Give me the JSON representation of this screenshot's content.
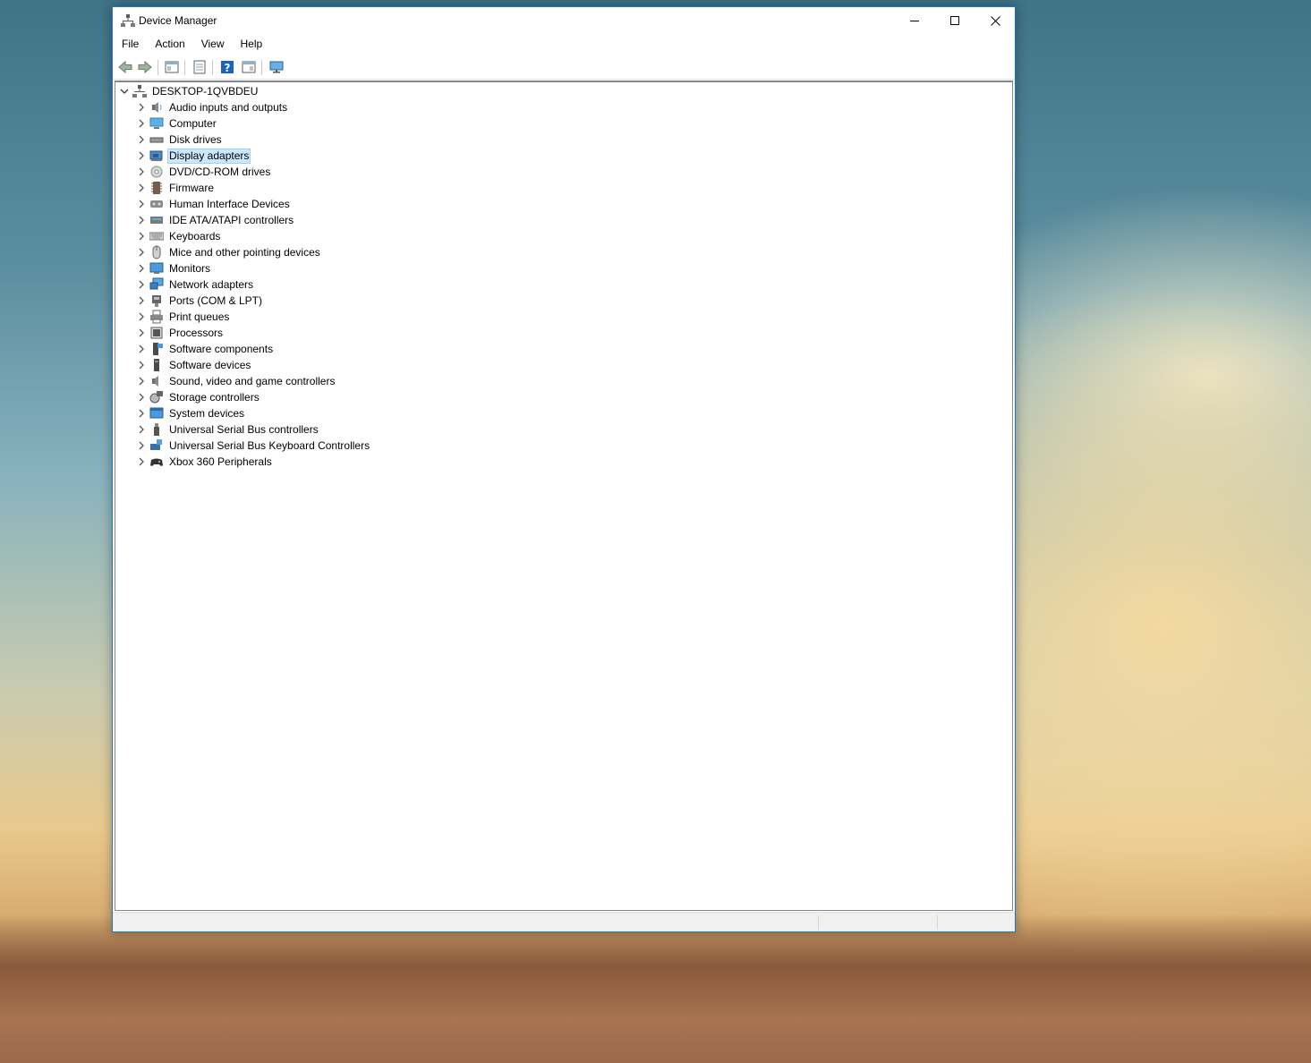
{
  "window": {
    "title": "Device Manager",
    "buttons": {
      "minimize": "minimize",
      "maximize": "maximize",
      "close": "close"
    }
  },
  "menu": {
    "items": [
      "File",
      "Action",
      "View",
      "Help"
    ]
  },
  "toolbar": {
    "buttons": [
      "back-icon",
      "forward-icon",
      "show-hide-console-tree-icon",
      "properties-icon",
      "help-icon",
      "action-pane-icon",
      "monitor-icon"
    ]
  },
  "tree": {
    "root": {
      "label": "DESKTOP-1QVBDEU",
      "expanded": true,
      "icon": "computer-network-icon"
    },
    "items": [
      {
        "label": "Audio inputs and outputs",
        "icon": "speaker-icon"
      },
      {
        "label": "Computer",
        "icon": "computer-icon"
      },
      {
        "label": "Disk drives",
        "icon": "disk-drive-icon"
      },
      {
        "label": "Display adapters",
        "icon": "display-adapter-icon",
        "selected": true
      },
      {
        "label": "DVD/CD-ROM drives",
        "icon": "dvd-icon"
      },
      {
        "label": "Firmware",
        "icon": "firmware-icon"
      },
      {
        "label": "Human Interface Devices",
        "icon": "hid-icon"
      },
      {
        "label": "IDE ATA/ATAPI controllers",
        "icon": "ide-controller-icon"
      },
      {
        "label": "Keyboards",
        "icon": "keyboard-icon"
      },
      {
        "label": "Mice and other pointing devices",
        "icon": "mouse-icon"
      },
      {
        "label": "Monitors",
        "icon": "monitor-icon"
      },
      {
        "label": "Network adapters",
        "icon": "network-adapter-icon"
      },
      {
        "label": "Ports (COM & LPT)",
        "icon": "port-icon"
      },
      {
        "label": "Print queues",
        "icon": "printer-icon"
      },
      {
        "label": "Processors",
        "icon": "processor-icon"
      },
      {
        "label": "Software components",
        "icon": "software-component-icon"
      },
      {
        "label": "Software devices",
        "icon": "software-device-icon"
      },
      {
        "label": "Sound, video and game controllers",
        "icon": "sound-icon"
      },
      {
        "label": "Storage controllers",
        "icon": "storage-controller-icon"
      },
      {
        "label": "System devices",
        "icon": "system-device-icon"
      },
      {
        "label": "Universal Serial Bus controllers",
        "icon": "usb-icon"
      },
      {
        "label": "Universal Serial Bus Keyboard Controllers",
        "icon": "usb-keyboard-icon"
      },
      {
        "label": "Xbox 360 Peripherals",
        "icon": "gamepad-icon"
      }
    ]
  },
  "colors": {
    "accent": "#1c79c8",
    "selection_bg": "#cce8ff",
    "selection_border": "#99d1ff"
  }
}
